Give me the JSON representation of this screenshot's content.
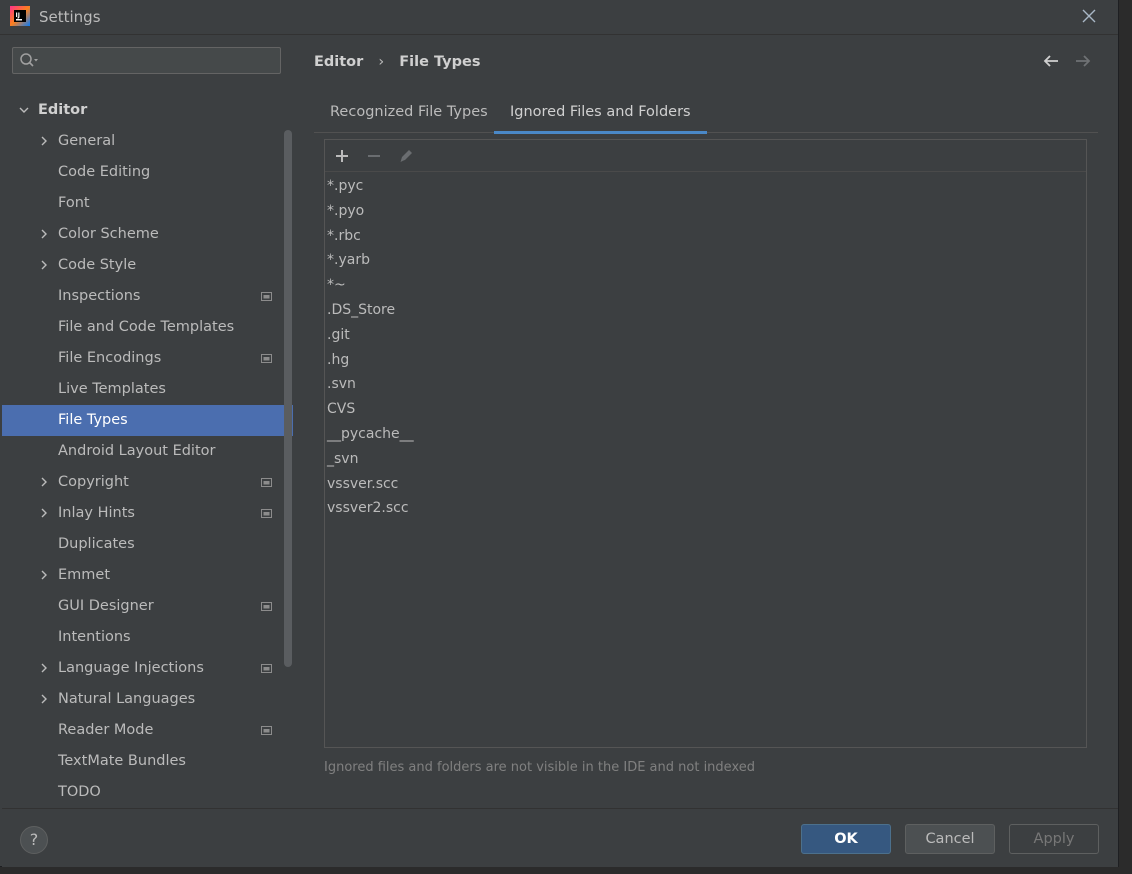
{
  "window": {
    "title": "Settings",
    "close_glyph": "✕"
  },
  "search": {
    "placeholder": "",
    "value": ""
  },
  "sidebar": {
    "root": {
      "label": "Editor",
      "expanded": true
    },
    "items": [
      {
        "label": "General",
        "expandable": true,
        "mark": false
      },
      {
        "label": "Code Editing",
        "expandable": false,
        "mark": false
      },
      {
        "label": "Font",
        "expandable": false,
        "mark": false
      },
      {
        "label": "Color Scheme",
        "expandable": true,
        "mark": false
      },
      {
        "label": "Code Style",
        "expandable": true,
        "mark": false
      },
      {
        "label": "Inspections",
        "expandable": false,
        "mark": true
      },
      {
        "label": "File and Code Templates",
        "expandable": false,
        "mark": false
      },
      {
        "label": "File Encodings",
        "expandable": false,
        "mark": true
      },
      {
        "label": "Live Templates",
        "expandable": false,
        "mark": false
      },
      {
        "label": "File Types",
        "expandable": false,
        "mark": false,
        "selected": true
      },
      {
        "label": "Android Layout Editor",
        "expandable": false,
        "mark": false
      },
      {
        "label": "Copyright",
        "expandable": true,
        "mark": true
      },
      {
        "label": "Inlay Hints",
        "expandable": true,
        "mark": true
      },
      {
        "label": "Duplicates",
        "expandable": false,
        "mark": false
      },
      {
        "label": "Emmet",
        "expandable": true,
        "mark": false
      },
      {
        "label": "GUI Designer",
        "expandable": false,
        "mark": true
      },
      {
        "label": "Intentions",
        "expandable": false,
        "mark": false
      },
      {
        "label": "Language Injections",
        "expandable": true,
        "mark": true
      },
      {
        "label": "Natural Languages",
        "expandable": true,
        "mark": false
      },
      {
        "label": "Reader Mode",
        "expandable": false,
        "mark": true
      },
      {
        "label": "TextMate Bundles",
        "expandable": false,
        "mark": false
      },
      {
        "label": "TODO",
        "expandable": false,
        "mark": false
      }
    ]
  },
  "breadcrumb": {
    "parent": "Editor",
    "separator": "›",
    "current": "File Types"
  },
  "tabs": [
    {
      "label": "Recognized File Types",
      "active": false
    },
    {
      "label": "Ignored Files and Folders",
      "active": true
    }
  ],
  "toolbar": {
    "add_icon": "plus-icon",
    "remove_icon": "minus-icon",
    "edit_icon": "pencil-icon"
  },
  "ignored_list": [
    "*.pyc",
    "*.pyo",
    "*.rbc",
    "*.yarb",
    "*~",
    ".DS_Store",
    ".git",
    ".hg",
    ".svn",
    "CVS",
    "__pycache__",
    "_svn",
    "vssver.scc",
    "vssver2.scc"
  ],
  "hint": "Ignored files and folders are not visible in the IDE and not indexed",
  "footer": {
    "help_label": "?",
    "ok_label": "OK",
    "cancel_label": "Cancel",
    "apply_label": "Apply"
  },
  "colors": {
    "selection": "#4b6eaf",
    "accent": "#4a88c7",
    "ok_button": "#365880"
  }
}
